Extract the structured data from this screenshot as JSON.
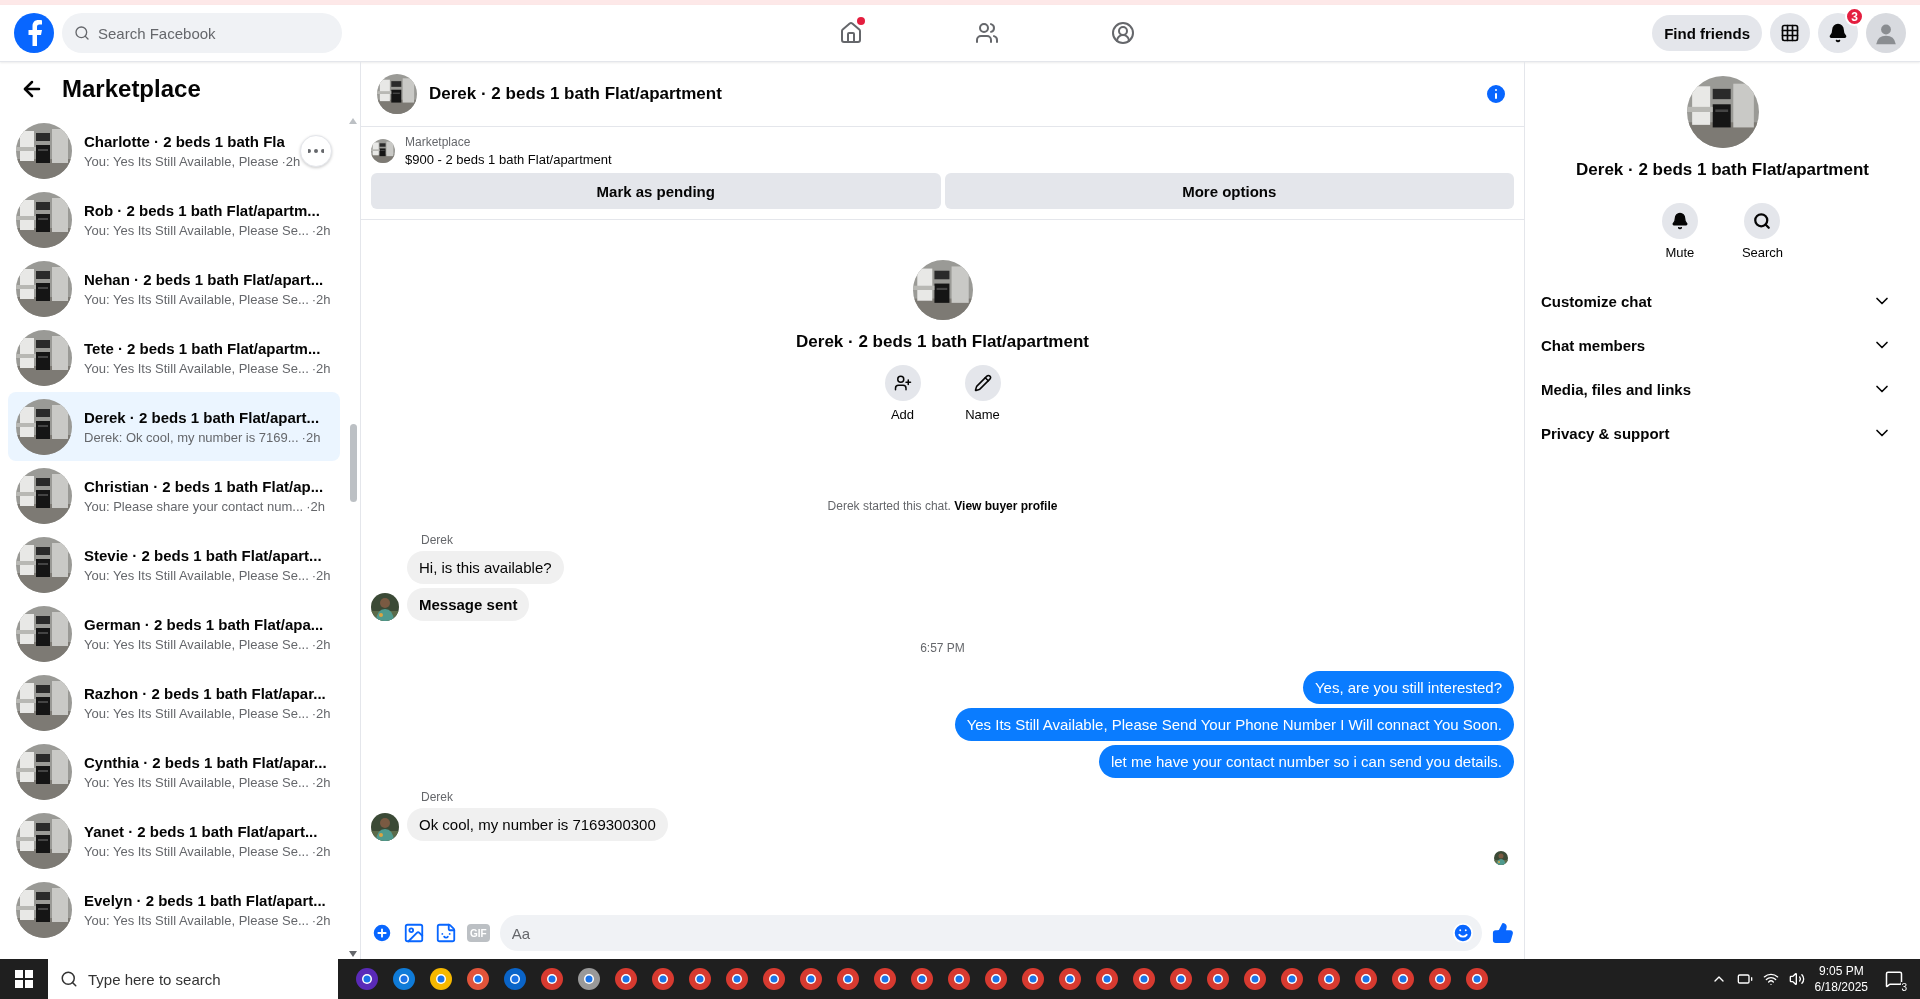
{
  "topbar": {
    "search_placeholder": "Search Facebook",
    "nav": [
      {
        "kind": "home",
        "dot": true
      },
      {
        "kind": "friends",
        "dot": false
      },
      {
        "kind": "groups",
        "dot": false
      }
    ],
    "find_friends": "Find friends",
    "notification_count": "3"
  },
  "sidebar": {
    "title": "Marketplace",
    "conversations": [
      {
        "name": "Charlotte · 2 beds 1 bath Fla",
        "preview": "You: Yes Its Still Available, Please",
        "time": "·2h",
        "selected": false,
        "more_button": true
      },
      {
        "name": "Rob · 2 beds 1 bath Flat/apartm...",
        "preview": "You: Yes Its Still Available, Please Se...",
        "time": "·2h",
        "selected": false,
        "more_button": false
      },
      {
        "name": "Nehan · 2 beds 1 bath Flat/apart...",
        "preview": "You: Yes Its Still Available, Please Se...",
        "time": "·2h",
        "selected": false,
        "more_button": false
      },
      {
        "name": "Tete · 2 beds 1 bath Flat/apartm...",
        "preview": "You: Yes Its Still Available, Please Se...",
        "time": "·2h",
        "selected": false,
        "more_button": false
      },
      {
        "name": "Derek · 2 beds 1 bath Flat/apart...",
        "preview": "Derek: Ok cool, my number is 7169...",
        "time": "·2h",
        "selected": true,
        "more_button": false
      },
      {
        "name": "Christian · 2 beds 1 bath Flat/ap...",
        "preview": "You: Please share your contact num...",
        "time": "·2h",
        "selected": false,
        "more_button": false
      },
      {
        "name": "Stevie · 2 beds 1 bath Flat/apart...",
        "preview": "You: Yes Its Still Available, Please Se...",
        "time": "·2h",
        "selected": false,
        "more_button": false
      },
      {
        "name": "German · 2 beds 1 bath Flat/apa...",
        "preview": "You: Yes Its Still Available, Please Se...",
        "time": "·2h",
        "selected": false,
        "more_button": false
      },
      {
        "name": "Razhon · 2 beds 1 bath Flat/apar...",
        "preview": "You: Yes Its Still Available, Please Se...",
        "time": "·2h",
        "selected": false,
        "more_button": false
      },
      {
        "name": "Cynthia · 2 beds 1 bath Flat/apar...",
        "preview": "You: Yes Its Still Available, Please Se...",
        "time": "·2h",
        "selected": false,
        "more_button": false
      },
      {
        "name": "Yanet · 2 beds 1 bath Flat/apart...",
        "preview": "You: Yes Its Still Available, Please Se...",
        "time": "·2h",
        "selected": false,
        "more_button": false
      },
      {
        "name": "Evelyn · 2 beds 1 bath Flat/apart...",
        "preview": "You: Yes Its Still Available, Please Se...",
        "time": "·2h",
        "selected": false,
        "more_button": false
      }
    ]
  },
  "chat": {
    "title": "Derek · 2 beds 1 bath Flat/apartment",
    "listing": {
      "source": "Marketplace",
      "summary": "$900 - 2 beds 1 bath Flat/apartment"
    },
    "actions": [
      "Mark as pending",
      "More options"
    ],
    "intro": {
      "title": "Derek · 2 beds 1 bath Flat/apartment",
      "buttons": [
        {
          "kind": "add",
          "label": "Add"
        },
        {
          "kind": "name",
          "label": "Name"
        }
      ]
    },
    "started": {
      "text": "Derek started this chat.",
      "link": "View buyer profile"
    },
    "blocks": [
      {
        "kind": "incoming",
        "sender": "Derek",
        "bubbles": [
          {
            "text": "Hi, is this available?",
            "bold": false
          },
          {
            "text": "Message sent",
            "bold": true
          }
        ]
      },
      {
        "kind": "time",
        "text": "6:57 PM"
      },
      {
        "kind": "outgoing",
        "bubbles": [
          {
            "text": "Yes, are you still interested?",
            "bold": false
          },
          {
            "text": "Yes Its Still Available, Please Send Your Phone Number I Will connact You Soon.",
            "bold": false
          },
          {
            "text": "let me have your contact number so i can send you details.",
            "bold": false
          }
        ]
      },
      {
        "kind": "incoming",
        "sender": "Derek",
        "bubbles": [
          {
            "text": "Ok cool, my number is 7169300300",
            "bold": false
          }
        ]
      }
    ],
    "seen": true,
    "composer": {
      "placeholder": "Aa",
      "gif": "GIF"
    }
  },
  "details": {
    "title": "Derek · 2 beds 1 bath Flat/apartment",
    "actions": [
      {
        "kind": "mute",
        "label": "Mute"
      },
      {
        "kind": "search",
        "label": "Search"
      }
    ],
    "sections": [
      {
        "label": "Customize chat",
        "expanded": false
      },
      {
        "label": "Chat members",
        "expanded": false
      },
      {
        "label": "Media, files and links",
        "expanded": false
      },
      {
        "label": "Privacy & support",
        "expanded": false
      }
    ]
  },
  "taskbar": {
    "search_placeholder": "Type here to search",
    "time": "9:05 PM",
    "date": "6/18/2025",
    "notification_count": "3"
  }
}
